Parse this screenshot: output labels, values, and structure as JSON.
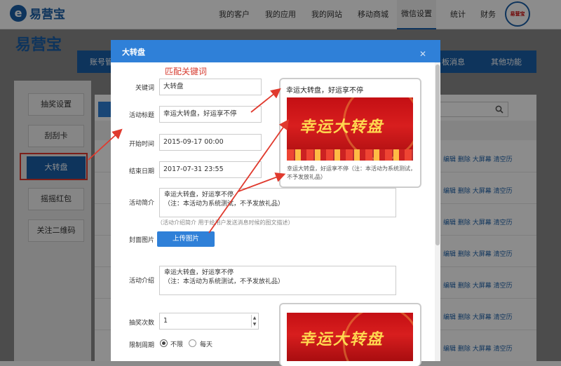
{
  "brand": {
    "name": "易营宝",
    "avatar_text": "易营宝"
  },
  "top_nav": [
    "我的客户",
    "我的应用",
    "我的网站",
    "移动商城",
    "微信设置",
    "统计",
    "财务"
  ],
  "sub_nav": {
    "left": "账号管",
    "right1": "板消息",
    "right2": "其他功能"
  },
  "sidebar": [
    "抽奖设置",
    "刮刮卡",
    "大转盘",
    "摇摇红包",
    "关注二维码"
  ],
  "row_actions": "编辑 删除 大屏幕 清空历",
  "modal": {
    "title": "大转盘",
    "annotation": "匹配关键词",
    "fields": {
      "keyword_label": "关键词",
      "keyword": "大转盘",
      "title_label": "活动标题",
      "title": "幸运大转盘，好运享不停",
      "start_label": "开始时间",
      "start": "2015-09-17 00:00",
      "end_label": "结束日期",
      "end": "2017-07-31 23:55",
      "summary_label": "活动简介",
      "summary": "幸运大转盘，好运享不停\n（注：本活动为系统测试，不予发放礼品）",
      "summary_hint": "（活动介绍简介 用于给用户发送消息时候的图文描述）",
      "cover_label": "封面图片",
      "upload": "上传图片",
      "intro_label": "活动介绍",
      "intro": "幸运大转盘，好运享不停\n（注：本活动为系统测试，不予发放礼品）",
      "draws_label": "抽奖次数",
      "draws": "1",
      "limit_label": "限制周期",
      "limit_options": [
        "不限",
        "每天"
      ]
    },
    "preview": {
      "title": "幸运大转盘，好运享不停",
      "banner_text": "幸运大转盘",
      "desc": "幸运大转盘，好运享不停（注：本活动为系统测试，不予发放礼品）"
    }
  },
  "colors": {
    "primary": "#2f80d8",
    "nav_blue": "#1a5fa8",
    "annotation": "#d63a2e"
  }
}
